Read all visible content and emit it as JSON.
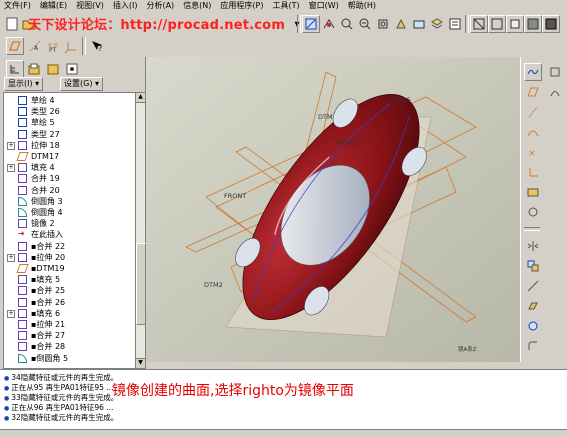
{
  "menu": [
    "文件(F)",
    "编辑(E)",
    "视图(V)",
    "插入(I)",
    "分析(A)",
    "信息(N)",
    "应用程序(P)",
    "工具(T)",
    "窗口(W)",
    "帮助(H)"
  ],
  "watermark": "天下设计论坛：http://procad.net.com",
  "panel": {
    "show_label": "显示(I) ▾",
    "settings_label": "设置(G) ▾"
  },
  "tree": [
    {
      "label": "草绘 4",
      "icon": "sketch-icon",
      "expand": false
    },
    {
      "label": "类型 26",
      "icon": "surface-icon",
      "expand": false
    },
    {
      "label": "草绘 5",
      "icon": "sketch-icon",
      "expand": false
    },
    {
      "label": "类型 27",
      "icon": "surface-icon",
      "expand": false
    },
    {
      "label": "拉伸 18",
      "icon": "extrude-icon",
      "expand": true
    },
    {
      "label": "DTM17",
      "icon": "datum-plane-icon",
      "expand": false
    },
    {
      "label": "填充 4",
      "icon": "fill-icon",
      "expand": true
    },
    {
      "label": "合并 19",
      "icon": "merge-icon",
      "expand": false
    },
    {
      "label": "合并 20",
      "icon": "merge-icon",
      "expand": false
    },
    {
      "label": "倒圆角 3",
      "icon": "round-icon",
      "expand": false
    },
    {
      "label": "倒圆角 4",
      "icon": "round-icon",
      "expand": false
    },
    {
      "label": "镜像 2",
      "icon": "mirror-icon",
      "expand": false
    },
    {
      "label": "在此插入",
      "icon": "insert-here-icon",
      "expand": false
    },
    {
      "label": "▪合并 22",
      "icon": "merge-icon",
      "expand": false
    },
    {
      "label": "▪拉伸 20",
      "icon": "extrude-icon",
      "expand": true
    },
    {
      "label": "▪DTM19",
      "icon": "datum-plane-icon",
      "expand": false
    },
    {
      "label": "▪填充 5",
      "icon": "fill-icon",
      "expand": false
    },
    {
      "label": "▪合并 25",
      "icon": "merge-icon",
      "expand": false
    },
    {
      "label": "▪合并 26",
      "icon": "merge-icon",
      "expand": false
    },
    {
      "label": "▪填充 6",
      "icon": "fill-icon",
      "expand": true
    },
    {
      "label": "▪拉伸 21",
      "icon": "extrude-icon",
      "expand": false
    },
    {
      "label": "▪合并 27",
      "icon": "merge-icon",
      "expand": false
    },
    {
      "label": "▪合并 28",
      "icon": "merge-icon",
      "expand": false
    },
    {
      "label": "▪倒圆角 5",
      "icon": "round-icon",
      "expand": false
    }
  ],
  "viewport_labels": {
    "front": "FRONT",
    "dtm2": "DTM2",
    "righto": "RIGHTO",
    "dtm15": "DTM15",
    "dtm": "DTM",
    "corner": "镜A系Z"
  },
  "messages": [
    "34隐藏特征或元件的再生完成。",
    "正在从95 再生PA01特征95 ...",
    "33隐藏特征或元件的再生完成。",
    "正在从96 再生PA01特征96 ...",
    "32隐藏特征或元件的再生完成。"
  ],
  "caption": "镜像创建的曲面,选择righto为镜像平面",
  "colors": {
    "car_body": "#8b1418",
    "datum_line": "#d07a30",
    "caption": "#e80000",
    "watermark": "#ff2020"
  }
}
